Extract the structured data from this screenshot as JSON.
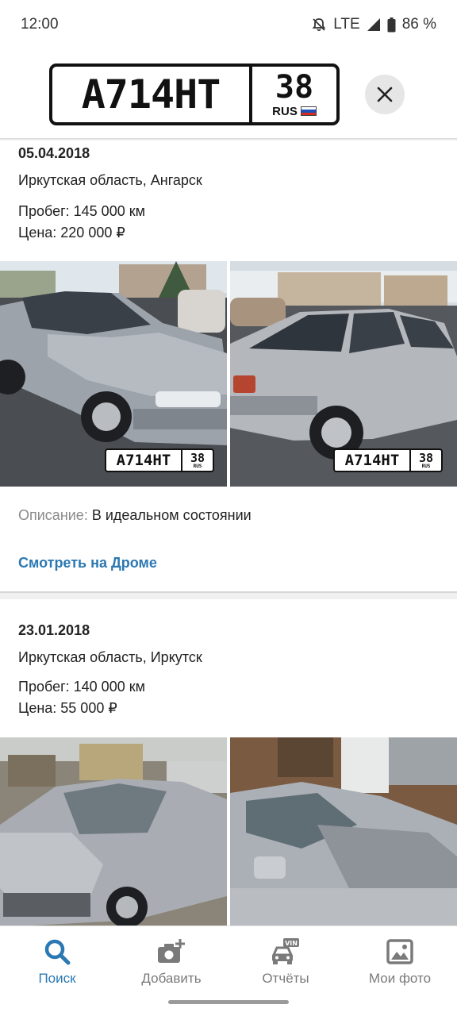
{
  "status": {
    "time": "12:00",
    "network": "LTE",
    "battery": "86 %"
  },
  "header": {
    "plate_main": "А714НТ",
    "plate_region": "38",
    "plate_country": "RUS",
    "close_icon": "close-icon"
  },
  "records": [
    {
      "date": "05.04.2018",
      "location": "Иркутская область, Ангарск",
      "mileage": "Пробег: 145 000 км",
      "price": "Цена: 220 000 ₽",
      "photo_plate_main": "А714НТ",
      "photo_plate_region": "38",
      "photo_plate_country": "RUS",
      "description_label": "Описание:",
      "description_value": "В идеальном состоянии",
      "link": "Смотреть на Дроме"
    },
    {
      "date": "23.01.2018",
      "location": "Иркутская область, Иркутск",
      "mileage": "Пробег: 140 000 км",
      "price": "Цена: 55 000 ₽"
    }
  ],
  "nav": {
    "items": [
      {
        "label": "Поиск",
        "icon": "search-icon",
        "active": true
      },
      {
        "label": "Добавить",
        "icon": "add-photo-icon",
        "active": false
      },
      {
        "label": "Отчёты",
        "icon": "vin-car-icon",
        "active": false
      },
      {
        "label": "Мои фото",
        "icon": "image-icon",
        "active": false
      }
    ]
  },
  "colors": {
    "accent": "#2b78b2",
    "muted": "#8a8a8a"
  }
}
